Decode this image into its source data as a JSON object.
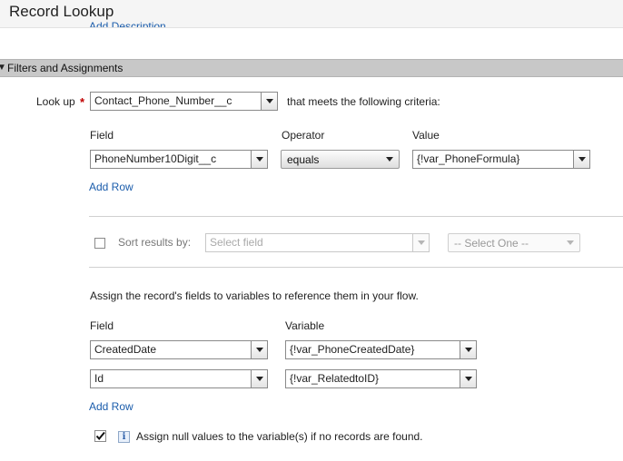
{
  "header": {
    "title": "Record Lookup",
    "add_description": "Add Description"
  },
  "section": {
    "title": "Filters and Assignments"
  },
  "lookup": {
    "label": "Look up",
    "required_mark": "*",
    "object": "Contact_Phone_Number__c",
    "criteria_text": "that meets the following criteria:"
  },
  "filters": {
    "headers": {
      "field": "Field",
      "operator": "Operator",
      "value": "Value"
    },
    "rows": [
      {
        "field": "PhoneNumber10Digit__c",
        "operator": "equals",
        "value": "{!var_PhoneFormula}"
      }
    ],
    "add_row": "Add Row"
  },
  "sort": {
    "label": "Sort results by:",
    "field_placeholder": "Select field",
    "order_placeholder": "-- Select One --"
  },
  "assign": {
    "description": "Assign the record's fields to variables to reference them in your flow.",
    "headers": {
      "field": "Field",
      "variable": "Variable"
    },
    "rows": [
      {
        "field": "CreatedDate",
        "variable": "{!var_PhoneCreatedDate}"
      },
      {
        "field": "Id",
        "variable": "{!var_RelatedtoID}"
      }
    ],
    "add_row": "Add Row"
  },
  "null_option": {
    "label": "Assign null values to the variable(s) if no records are found.",
    "checked": true
  }
}
